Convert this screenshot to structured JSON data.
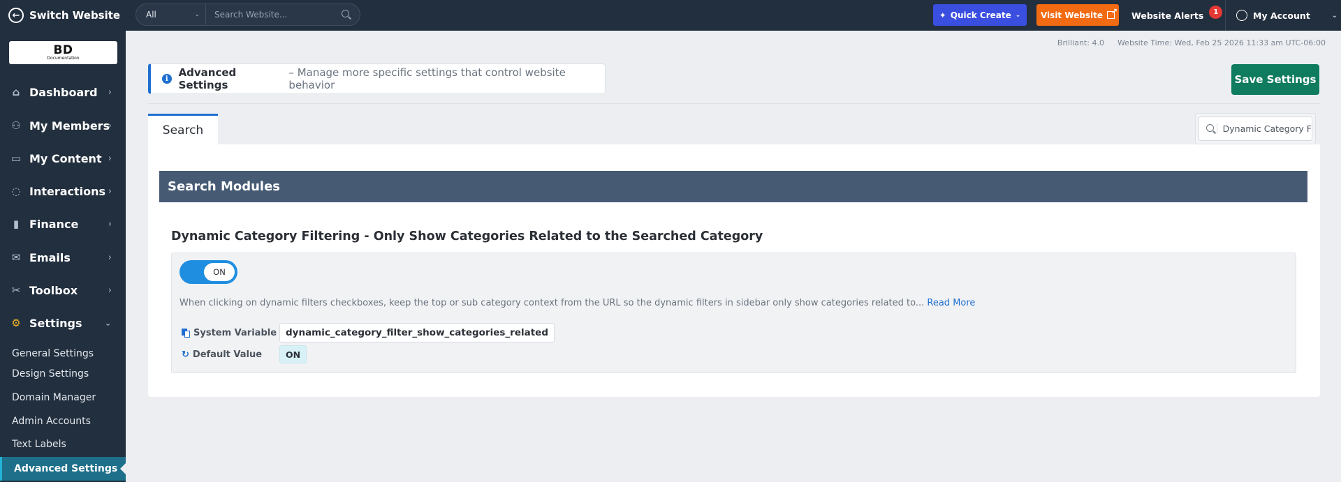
{
  "topbar": {
    "switch_label": "Switch Website",
    "filter_value": "All",
    "search_placeholder": "Search Website...",
    "quick_create": "Quick Create",
    "visit_website": "Visit Website",
    "alerts_label": "Website Alerts",
    "alerts_count": "1",
    "account_label": "My Account"
  },
  "logo": {
    "big": "BD",
    "small": "Documentation"
  },
  "sidebar": {
    "items": [
      {
        "label": "Dashboard",
        "icon": "home-icon"
      },
      {
        "label": "My Members",
        "icon": "members-icon"
      },
      {
        "label": "My Content",
        "icon": "folder-icon"
      },
      {
        "label": "Interactions",
        "icon": "chat-icon"
      },
      {
        "label": "Finance",
        "icon": "chart-icon"
      },
      {
        "label": "Emails",
        "icon": "email-icon"
      },
      {
        "label": "Toolbox",
        "icon": "tools-icon"
      },
      {
        "label": "Settings",
        "icon": "gear-icon"
      }
    ],
    "subitems": [
      "General Settings",
      "Design Settings",
      "Domain Manager",
      "Admin Accounts",
      "Text Labels",
      "Advanced Settings"
    ]
  },
  "meta": {
    "brilliant_label": "Brilliant:",
    "brilliant_value": "4.0",
    "time_label": "Website Time:",
    "time_value": "Wed, Feb 25 2026 11:33 am UTC-06:00"
  },
  "header": {
    "title": "Advanced Settings",
    "description": "– Manage more specific settings that control website behavior"
  },
  "save_label": "Save Settings",
  "tab_label": "Search",
  "filter_search_value": "Dynamic Category F",
  "section_title": "Search Modules",
  "feature": {
    "title": "Dynamic Category Filtering - Only Show Categories Related to the Searched Category",
    "toggle_label": "ON",
    "description": "When clicking on dynamic filters checkboxes, keep the top or sub category context from the URL so the dynamic filters in sidebar only show categories related to...",
    "read_more": "Read More",
    "system_variable_label": "System Variable",
    "system_variable_value": "dynamic_category_filter_show_categories_related",
    "default_value_label": "Default Value",
    "default_value": "ON"
  },
  "colors": {
    "topbar_bg": "#222f3e",
    "quick_create": "#3a4ee0",
    "visit_website": "#f26a12",
    "save_button": "#0f7b5f",
    "section_bar": "#465a74",
    "toggle_on": "#1f8ee0",
    "active_subitem": "#1e6f8a"
  }
}
